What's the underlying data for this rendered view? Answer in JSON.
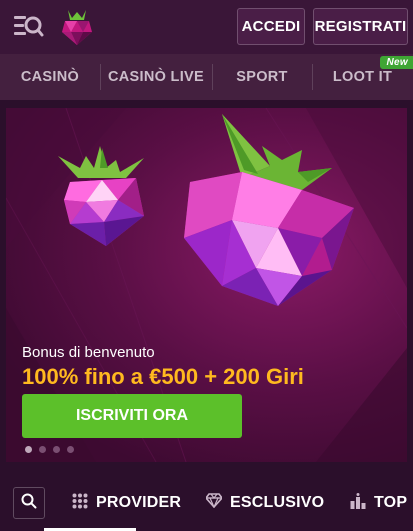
{
  "header": {
    "login_label": "ACCEDI",
    "register_label": "REGISTRATI"
  },
  "nav": {
    "items": [
      {
        "label": "CASINÒ"
      },
      {
        "label": "CASINÒ LIVE"
      },
      {
        "label": "SPORT"
      },
      {
        "label": "LOOT IT",
        "badge": "New"
      }
    ]
  },
  "hero": {
    "subtitle": "Bonus di benvenuto",
    "title": "100% fino a €500 + 200 Giri",
    "cta_label": "ISCRIVITI ORA",
    "slides_total": 4,
    "active_slide": 1
  },
  "filters": {
    "provider_label": "PROVIDER",
    "exclusive_label": "ESCLUSIVO",
    "top_label": "TOP"
  },
  "colors": {
    "background": "#2b0f2b",
    "header": "#3a1638",
    "nav": "#44203f",
    "accent_gold": "#ffb91f",
    "cta_green": "#5cc02a",
    "badge_green": "#3fa534"
  },
  "icons": [
    "menu-search-icon",
    "raspberry-logo",
    "search-icon",
    "grid-icon",
    "diamond-icon",
    "podium-icon"
  ]
}
